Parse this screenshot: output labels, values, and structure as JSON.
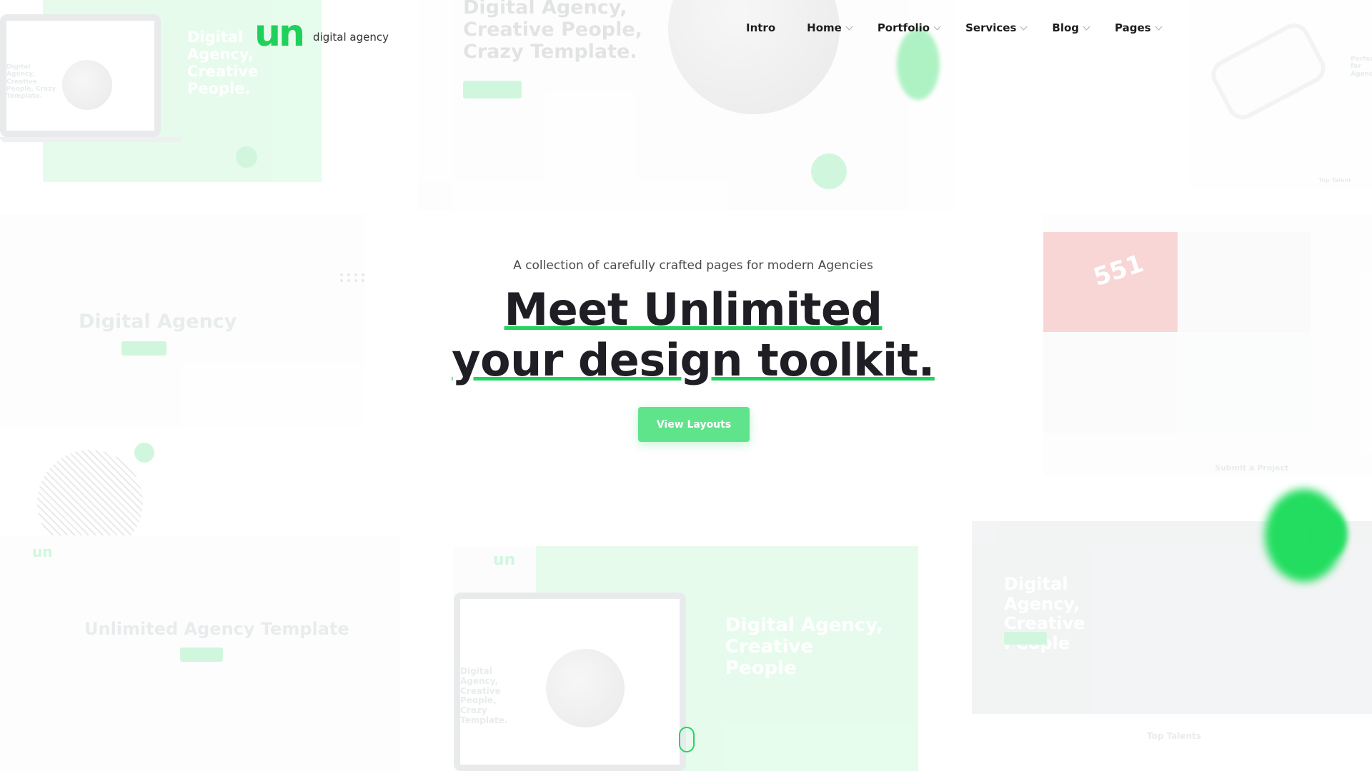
{
  "header": {
    "logo_mark": "un",
    "logo_subtitle": "digital agency"
  },
  "nav": {
    "items": [
      {
        "label": "Intro",
        "has_dropdown": false
      },
      {
        "label": "Home",
        "has_dropdown": true
      },
      {
        "label": "Portfolio",
        "has_dropdown": true
      },
      {
        "label": "Services",
        "has_dropdown": true
      },
      {
        "label": "Blog",
        "has_dropdown": true
      },
      {
        "label": "Pages",
        "has_dropdown": true
      }
    ]
  },
  "hero": {
    "tagline": "A collection of carefully crafted pages for modern Agencies",
    "headline_line1": "Meet Unlimited",
    "headline_line2": "your design toolkit.",
    "cta_label": "View Layouts"
  },
  "background_previews": {
    "top_left_title": "Digital Agency, Creative People.",
    "top_left_laptop_text": "Digital Agency, Creative People, Crazy Template.",
    "top_center_title": "Digital Agency, Creative People, Crazy Template.",
    "mid_left_title": "Digital Agency",
    "mid_right_badge": "551",
    "mid_right_footer": "Submit a Project",
    "bottom_left_logo": "un",
    "bottom_left_title": "Unlimited Agency Template",
    "bottom_center_logo": "un",
    "bottom_center_laptop_text": "Digital Agency, Creative People, Crazy Template.",
    "bottom_center_title": "Digital Agency, Creative People",
    "bottom_right_title": "Digital Agency, Creative People",
    "bottom_right_footer": "Top Talents",
    "top_right_title": "Perfect for Agencies",
    "top_right_footer": "Top Talent"
  },
  "colors": {
    "accent": "#22d35e",
    "cta_bg": "#5fe48c",
    "heading": "#1e1e24",
    "text": "#4a4a4a"
  }
}
